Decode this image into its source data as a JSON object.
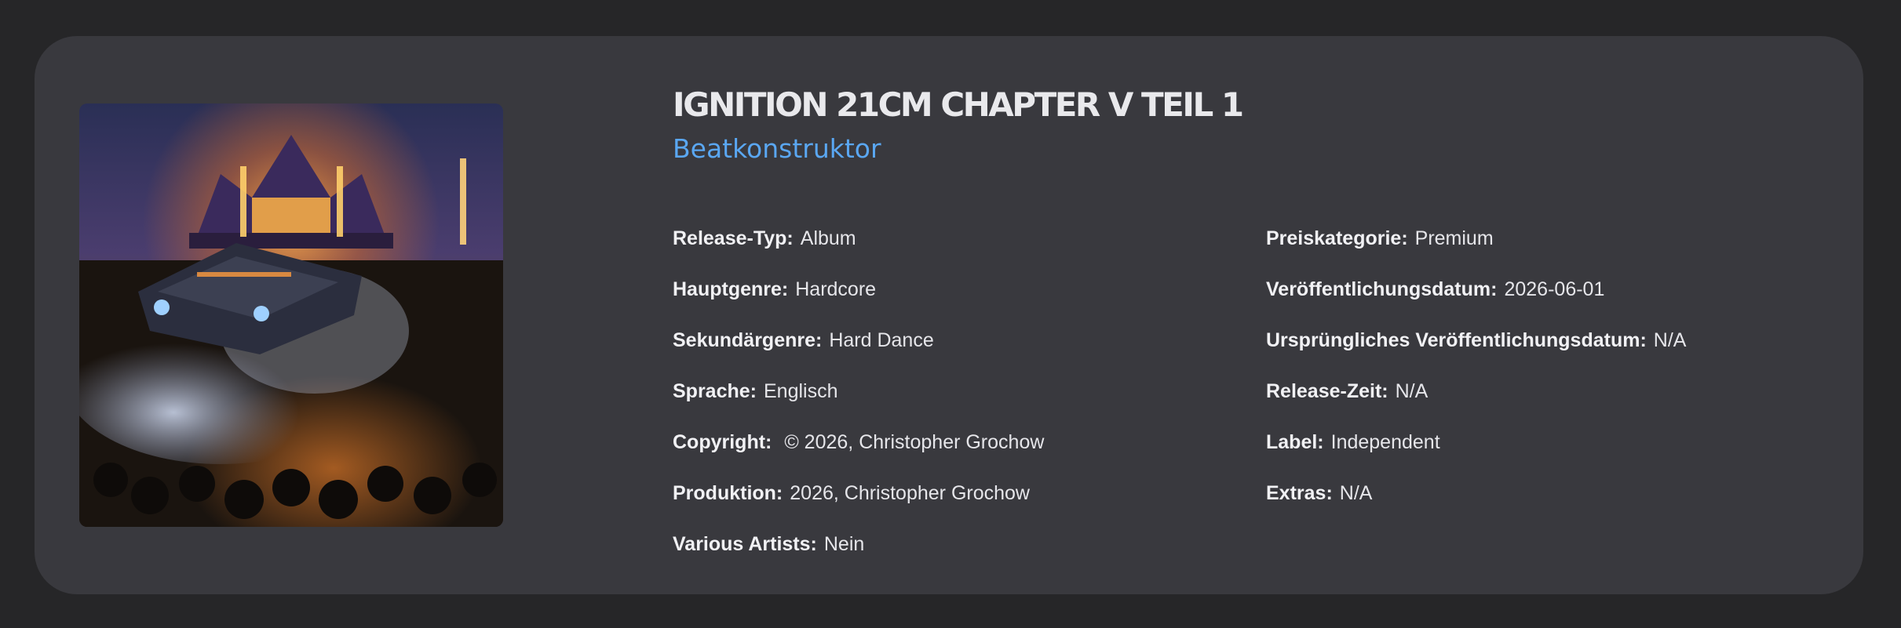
{
  "release": {
    "title": "IGNITION 21CM CHAPTER V TEIL 1",
    "artist": "Beatkonstruktor"
  },
  "details_left": [
    {
      "label": "Release-Typ:",
      "value": "Album"
    },
    {
      "label": "Hauptgenre:",
      "value": "Hardcore"
    },
    {
      "label": "Sekundärgenre:",
      "value": "Hard Dance"
    },
    {
      "label": "Sprache:",
      "value": "Englisch"
    },
    {
      "label": "Copyright:",
      "value": " © 2026, Christopher Grochow"
    },
    {
      "label": "Produktion:",
      "value": "2026, Christopher Grochow"
    },
    {
      "label": "Various Artists:",
      "value": "Nein"
    }
  ],
  "details_right": [
    {
      "label": "Preiskategorie:",
      "value": "Premium"
    },
    {
      "label": "Veröffentlichungsdatum:",
      "value": "2026-06-01"
    },
    {
      "label": "Ursprüngliches Veröffentlichungsdatum:",
      "value": "N/A"
    },
    {
      "label": "Release-Zeit:",
      "value": "N/A"
    },
    {
      "label": "Label:",
      "value": "Independent"
    },
    {
      "label": "Extras:",
      "value": "N/A"
    }
  ],
  "colors": {
    "page_bg": "#262628",
    "card_bg": "#39393e",
    "artist_link": "#5aa7f2"
  }
}
